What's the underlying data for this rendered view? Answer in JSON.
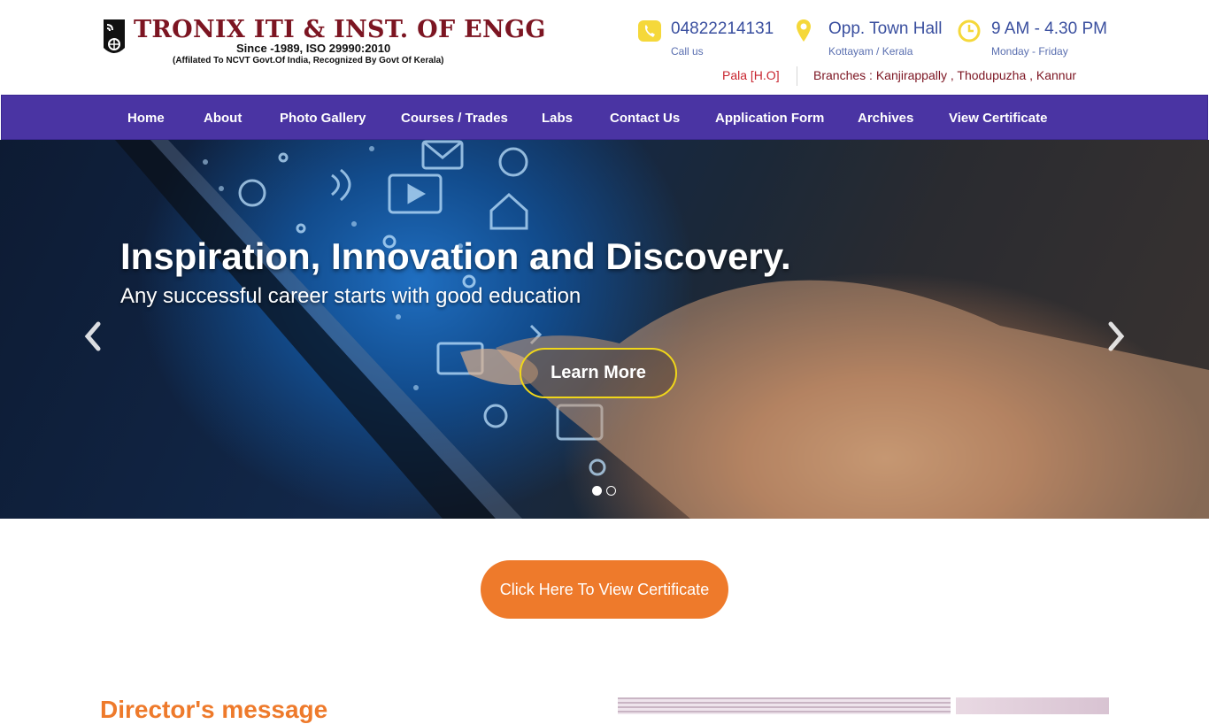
{
  "header": {
    "logo_title": "TRONIX ITI & INST. OF ENGG",
    "logo_since": "Since -1989, ISO 29990:2010",
    "logo_affiliation": "(Affilated To NCVT Govt.Of India, Recognized By Govt Of Kerala)",
    "phone": {
      "value": "04822214131",
      "sub": "Call us",
      "icon": "phone-icon"
    },
    "location": {
      "value": "Opp. Town Hall",
      "sub": "Kottayam / Kerala",
      "icon": "map-pin-icon"
    },
    "hours": {
      "value": "9 AM - 4.30 PM",
      "sub": "Monday - Friday",
      "icon": "clock-icon"
    },
    "head_office": "Pala [H.O]",
    "branches": "Branches : Kanjirappally , Thodupuzha , Kannur"
  },
  "nav": {
    "items": [
      {
        "label": "Home"
      },
      {
        "label": "About"
      },
      {
        "label": "Photo Gallery"
      },
      {
        "label": "Courses / Trades"
      },
      {
        "label": "Labs"
      },
      {
        "label": "Contact Us"
      },
      {
        "label": "Application Form"
      },
      {
        "label": "Archives"
      },
      {
        "label": "View Certificate"
      }
    ]
  },
  "hero": {
    "title": "Inspiration, Innovation and Discovery.",
    "subtitle": "Any successful career starts with good education",
    "button": "Learn More",
    "active_slide": 1,
    "slide_count": 2
  },
  "cta": {
    "certificate_button": "Click Here To View Certificate"
  },
  "director": {
    "title": "Director's message"
  },
  "colors": {
    "nav_bg": "#4a34a3",
    "brand_maroon": "#7c1522",
    "accent_orange": "#ee7a2b",
    "icon_yellow": "#f5d83a",
    "contact_blue": "#3a4f9f",
    "learn_border": "#f0d61a"
  }
}
